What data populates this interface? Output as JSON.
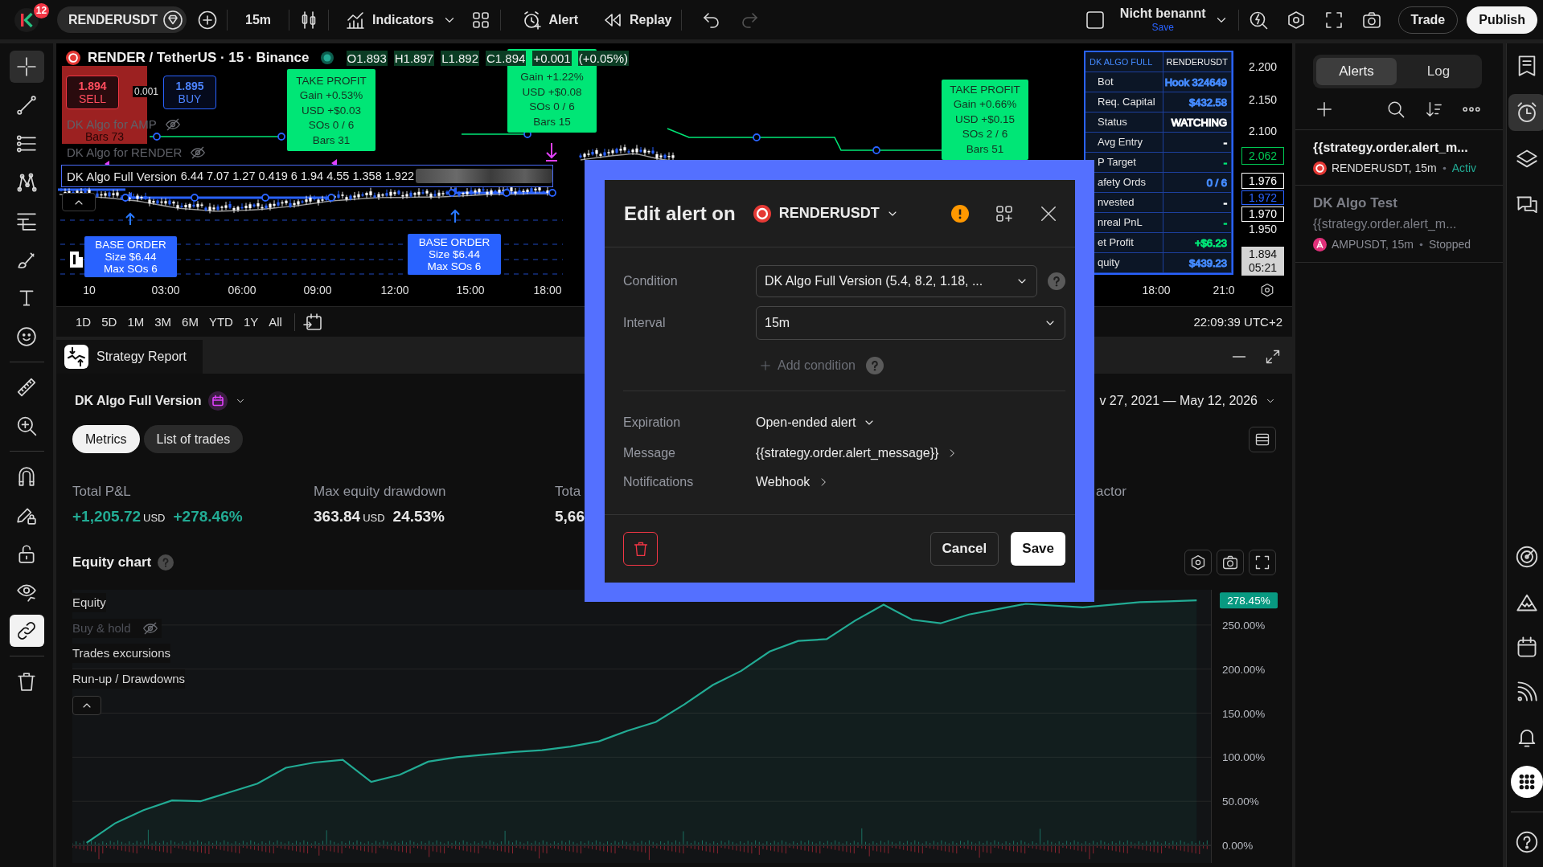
{
  "top_bar": {
    "logo_badge": "12",
    "symbol": "RENDERUSDT",
    "interval": "15m",
    "actions": [
      {
        "kind": "indicators",
        "label": "Indicators"
      },
      {
        "kind": "alert",
        "label": "Alert"
      },
      {
        "kind": "replay",
        "label": "Replay"
      }
    ],
    "history": [
      {
        "disabled": false
      },
      {
        "disabled": true
      }
    ],
    "layout_name": "Nicht benannt",
    "layout_save": "Save",
    "buttons": [
      {
        "kind": "outline",
        "label": "Trade"
      },
      {
        "kind": "primary",
        "label": "Publish"
      }
    ]
  },
  "left_toolbar": {
    "groups": [
      {
        "kind": "tools",
        "items": [
          {
            "selected": true
          },
          {
            "selected": false
          },
          {
            "selected": false
          },
          {
            "selected": false
          },
          {
            "selected": false
          },
          {
            "selected": false
          },
          {
            "selected": false
          },
          {
            "selected": false
          }
        ]
      },
      {
        "kind": "tools",
        "items": [
          {
            "selected": false
          },
          {
            "selected": false
          }
        ]
      },
      {
        "kind": "toggles",
        "items": [
          {
            "on": false
          },
          {
            "on": false
          },
          {
            "on": false
          },
          {
            "on": false
          },
          {
            "on": true
          }
        ]
      },
      {
        "kind": "tools",
        "items": [
          {
            "selected": false
          }
        ]
      }
    ]
  },
  "chart": {
    "legend": {
      "title": "RENDER / TetherUS · 15 · Binance",
      "market_open": true,
      "ohlc": [
        "O1.893",
        "H1.897",
        "L1.892",
        "C1.894"
      ],
      "change": "+0.001",
      "change_percent": "(+0.05%)"
    },
    "trade_buttons": [
      {
        "kind": "sell",
        "price": "1.894",
        "label": "SELL"
      },
      {
        "kind": "buy",
        "price": "1.895",
        "label": "BUY"
      }
    ],
    "spread": "0.001",
    "exit_label": {
      "lines": [
        "Bars 73"
      ]
    },
    "indicators": [
      {
        "name": "DK Algo for AMP",
        "hidden": true,
        "selected": false
      },
      {
        "name": "DK Algo for RENDER",
        "hidden": true,
        "selected": false
      },
      {
        "name": "DK Algo Full Version",
        "values": "6.44 7.07 1.27 0.419 6 1.94 4.55 1.358 1.922",
        "hidden": false,
        "selected": true,
        "redacted": true
      }
    ],
    "take_profit_labels": [
      {
        "lines": [
          "TAKE PROFIT",
          "Gain +0.53%",
          "USD +$0.03",
          "SOs 0 / 6",
          "Bars 31"
        ]
      },
      {
        "lines": [
          "Gain +1.22%",
          "USD +$0.08",
          "SOs 0 / 6",
          "Bars 15"
        ]
      },
      {
        "lines": [
          "TAKE PROFIT",
          "Gain +0.66%",
          "USD +$0.15",
          "SOs 2 / 6",
          "Bars 51"
        ]
      }
    ],
    "base_order_labels": [
      {
        "lines": [
          "BASE ORDER",
          "Size $6.44",
          "Max SOs 6"
        ]
      },
      {
        "lines": [
          "BASE ORDER",
          "Size $6.44",
          "Max SOs 6"
        ]
      }
    ],
    "time_axis": [
      "10",
      "03:00",
      "06:00",
      "09:00",
      "12:00",
      "15:00",
      "18:00",
      "18:00",
      "21:0"
    ],
    "price_axis": {
      "ticks": [
        "2.200",
        "2.150",
        "2.100",
        "1.950"
      ],
      "markers": [
        {
          "kind": "level",
          "label": "2.062",
          "color": "#00c853"
        },
        {
          "kind": "level",
          "label": "1.976",
          "color": "#ffffff"
        },
        {
          "kind": "level",
          "label": "1.972",
          "color": "#2962ff"
        },
        {
          "kind": "level",
          "label": "1.970",
          "color": "#ffffff"
        },
        {
          "kind": "current",
          "label": "1.894",
          "countdown": "05:21"
        }
      ]
    },
    "data_table": {
      "header": [
        "DK ALGO FULL",
        "RENDERUSDT"
      ],
      "rows": [
        {
          "label": "Bot",
          "value": "Hook 324649",
          "color": "#448aff"
        },
        {
          "label": "Req. Capital",
          "value": "$432.58",
          "color": "#448aff"
        },
        {
          "label": "Status",
          "value": "WATCHING",
          "color": "#ffffff"
        },
        {
          "label": "Avg Entry",
          "value": "-",
          "color": "#ffffff"
        },
        {
          "label": "P Target",
          "value": "-",
          "color": "#00e676"
        },
        {
          "label": "afety Ords",
          "value": "0 / 6",
          "color": "#448aff"
        },
        {
          "label": "nvested",
          "value": "-",
          "color": "#ffffff"
        },
        {
          "label": "nreal PnL",
          "value": "-",
          "color": "#00e676"
        },
        {
          "label": "et Profit",
          "value": "+$6.23",
          "color": "#00e676"
        },
        {
          "label": "quity",
          "value": "$439.23",
          "color": "#448aff"
        }
      ]
    }
  },
  "range_bar": {
    "periods": [
      "1D",
      "5D",
      "1M",
      "3M",
      "6M",
      "YTD",
      "1Y",
      "All"
    ],
    "clock": "22:09:39 UTC+2"
  },
  "strategy_report": {
    "tab": "Strategy Report",
    "strategy": "DK Algo Full Version",
    "date_range": "v 27, 2021 — May 12, 2026",
    "tabs": [
      {
        "label": "Metrics",
        "selected": true
      },
      {
        "label": "List of trades",
        "selected": false
      }
    ],
    "metrics": [
      {
        "label": "Total P&L",
        "value": "+1,205.72",
        "unit": "USD",
        "percent": "+278.46%",
        "positive": true
      },
      {
        "label": "Max equity drawdown",
        "value": "363.84",
        "unit": "USD",
        "percent": "24.53%",
        "positive": false
      },
      {
        "label": "Tota",
        "value": "5,66",
        "positive": false
      },
      {
        "label": "actor"
      }
    ],
    "equity_chart": {
      "title": "Equity chart",
      "legend": [
        {
          "label": "Equity",
          "hidden": false
        },
        {
          "label": "Buy & hold",
          "hidden": true
        },
        {
          "label": "Trades excursions",
          "hidden": false
        },
        {
          "label": "Run-up / Drawdowns",
          "hidden": false
        }
      ],
      "last_value": "278.45%",
      "chart_data": {
        "type": "area",
        "grid": true,
        "ylim": [
          -20,
          290
        ],
        "yticks": [
          {
            "value": 0,
            "label": "0.00%"
          },
          {
            "value": 50,
            "label": "50.00%"
          },
          {
            "value": 100,
            "label": "100.00%"
          },
          {
            "value": 150,
            "label": "150.00%"
          },
          {
            "value": 200,
            "label": "200.00%"
          },
          {
            "value": 250,
            "label": "250.00%"
          }
        ],
        "series": [
          {
            "color": "#22ab94",
            "values": [
              3,
              25,
              40,
              51,
              50,
              60,
              70,
              88,
              94,
              97,
              72,
              80,
              95,
              100,
              103,
              106,
              108,
              112,
              118,
              130,
              140,
              160,
              182,
              198,
              220,
              232,
              234,
              255,
              273,
              256,
              252,
              262,
              268,
              274,
              null,
              270,
              273,
              276,
              277,
              278
            ]
          }
        ]
      }
    }
  },
  "alerts_panel": {
    "tabs": [
      {
        "label": "Alerts",
        "selected": true
      },
      {
        "label": "Log",
        "selected": false
      }
    ],
    "alerts": [
      {
        "message": "{{strategy.order.alert_m...",
        "symbol": "RENDERUSDT, 15m",
        "status": "Activ",
        "active": true,
        "color": "#e53935"
      },
      {
        "name": "DK Algo Test",
        "message": "{{strategy.order.alert_m...",
        "symbol": "AMPUSDT, 15m",
        "status": "Stopped",
        "active": false,
        "color": "#e0307a"
      }
    ]
  },
  "right_toolbar": {
    "top": [
      {
        "selected": false
      },
      {
        "selected": true
      },
      {
        "selected": false
      },
      {
        "selected": false
      }
    ],
    "bottom": [
      {
        "selected": false
      },
      {
        "selected": false
      },
      {
        "selected": false
      },
      {
        "selected": false
      },
      {
        "selected": false
      },
      {
        "selected": false
      },
      {
        "selected": false
      }
    ]
  },
  "alert_dialog": {
    "title": "Edit alert on",
    "symbol": "RENDERUSDT",
    "warning": true,
    "fields": [
      {
        "label": "Condition",
        "value": "DK Algo Full Version (5.4, 8.2, 1.18, ...",
        "help": true
      },
      {
        "label": "Interval",
        "value": "15m",
        "help": false
      }
    ],
    "add_condition": "Add condition",
    "settings": [
      {
        "kind": "dropdown",
        "label": "Expiration",
        "value": "Open-ended alert"
      },
      {
        "kind": "link",
        "label": "Message",
        "value": "{{strategy.order.alert_message}}"
      },
      {
        "kind": "link",
        "label": "Notifications",
        "value": "Webhook"
      }
    ],
    "buttons": [
      {
        "kind": "secondary",
        "label": "Cancel"
      },
      {
        "kind": "primary",
        "label": "Save"
      }
    ]
  }
}
